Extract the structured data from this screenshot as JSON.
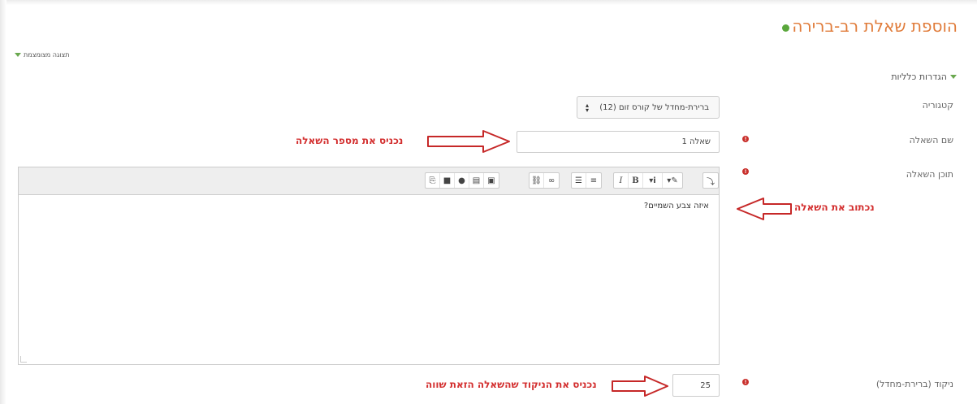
{
  "page_title": "הוספת שאלת רב-ברירה",
  "collapse_link": "תצוגה מצומצמת",
  "section_title": "הגדרות כלליות",
  "fields": {
    "category_label": "קטגוריה",
    "category_value": "ברירת-מחדל של קורס זום (12)",
    "name_label": "שם השאלה",
    "name_value": "שאלה 1",
    "content_label": "תוכן השאלה",
    "content_value": "איזה צבע השמיים?",
    "grade_label": "ניקוד (ברירת-מחדל)",
    "grade_value": "25"
  },
  "toolbar_icons": [
    "expand-icon",
    "format-icon",
    "info-icon",
    "bold-icon",
    "italic-icon",
    "unordered-list-icon",
    "ordered-list-icon",
    "link-icon",
    "unlink-icon",
    "image-icon",
    "media-icon",
    "record-audio-icon",
    "record-video-icon",
    "manage-files-icon"
  ],
  "annotations": {
    "name_note": "נכניס את מספר השאלה",
    "content_note": "נכתוב את השאלה",
    "grade_note": "נכניס את הניקוד שהשאלה הזאת שווה"
  },
  "colors": {
    "title": "#e07b39",
    "required": "#c9302c",
    "annotation": "#d32f2f",
    "expand": "#6aa84f"
  }
}
